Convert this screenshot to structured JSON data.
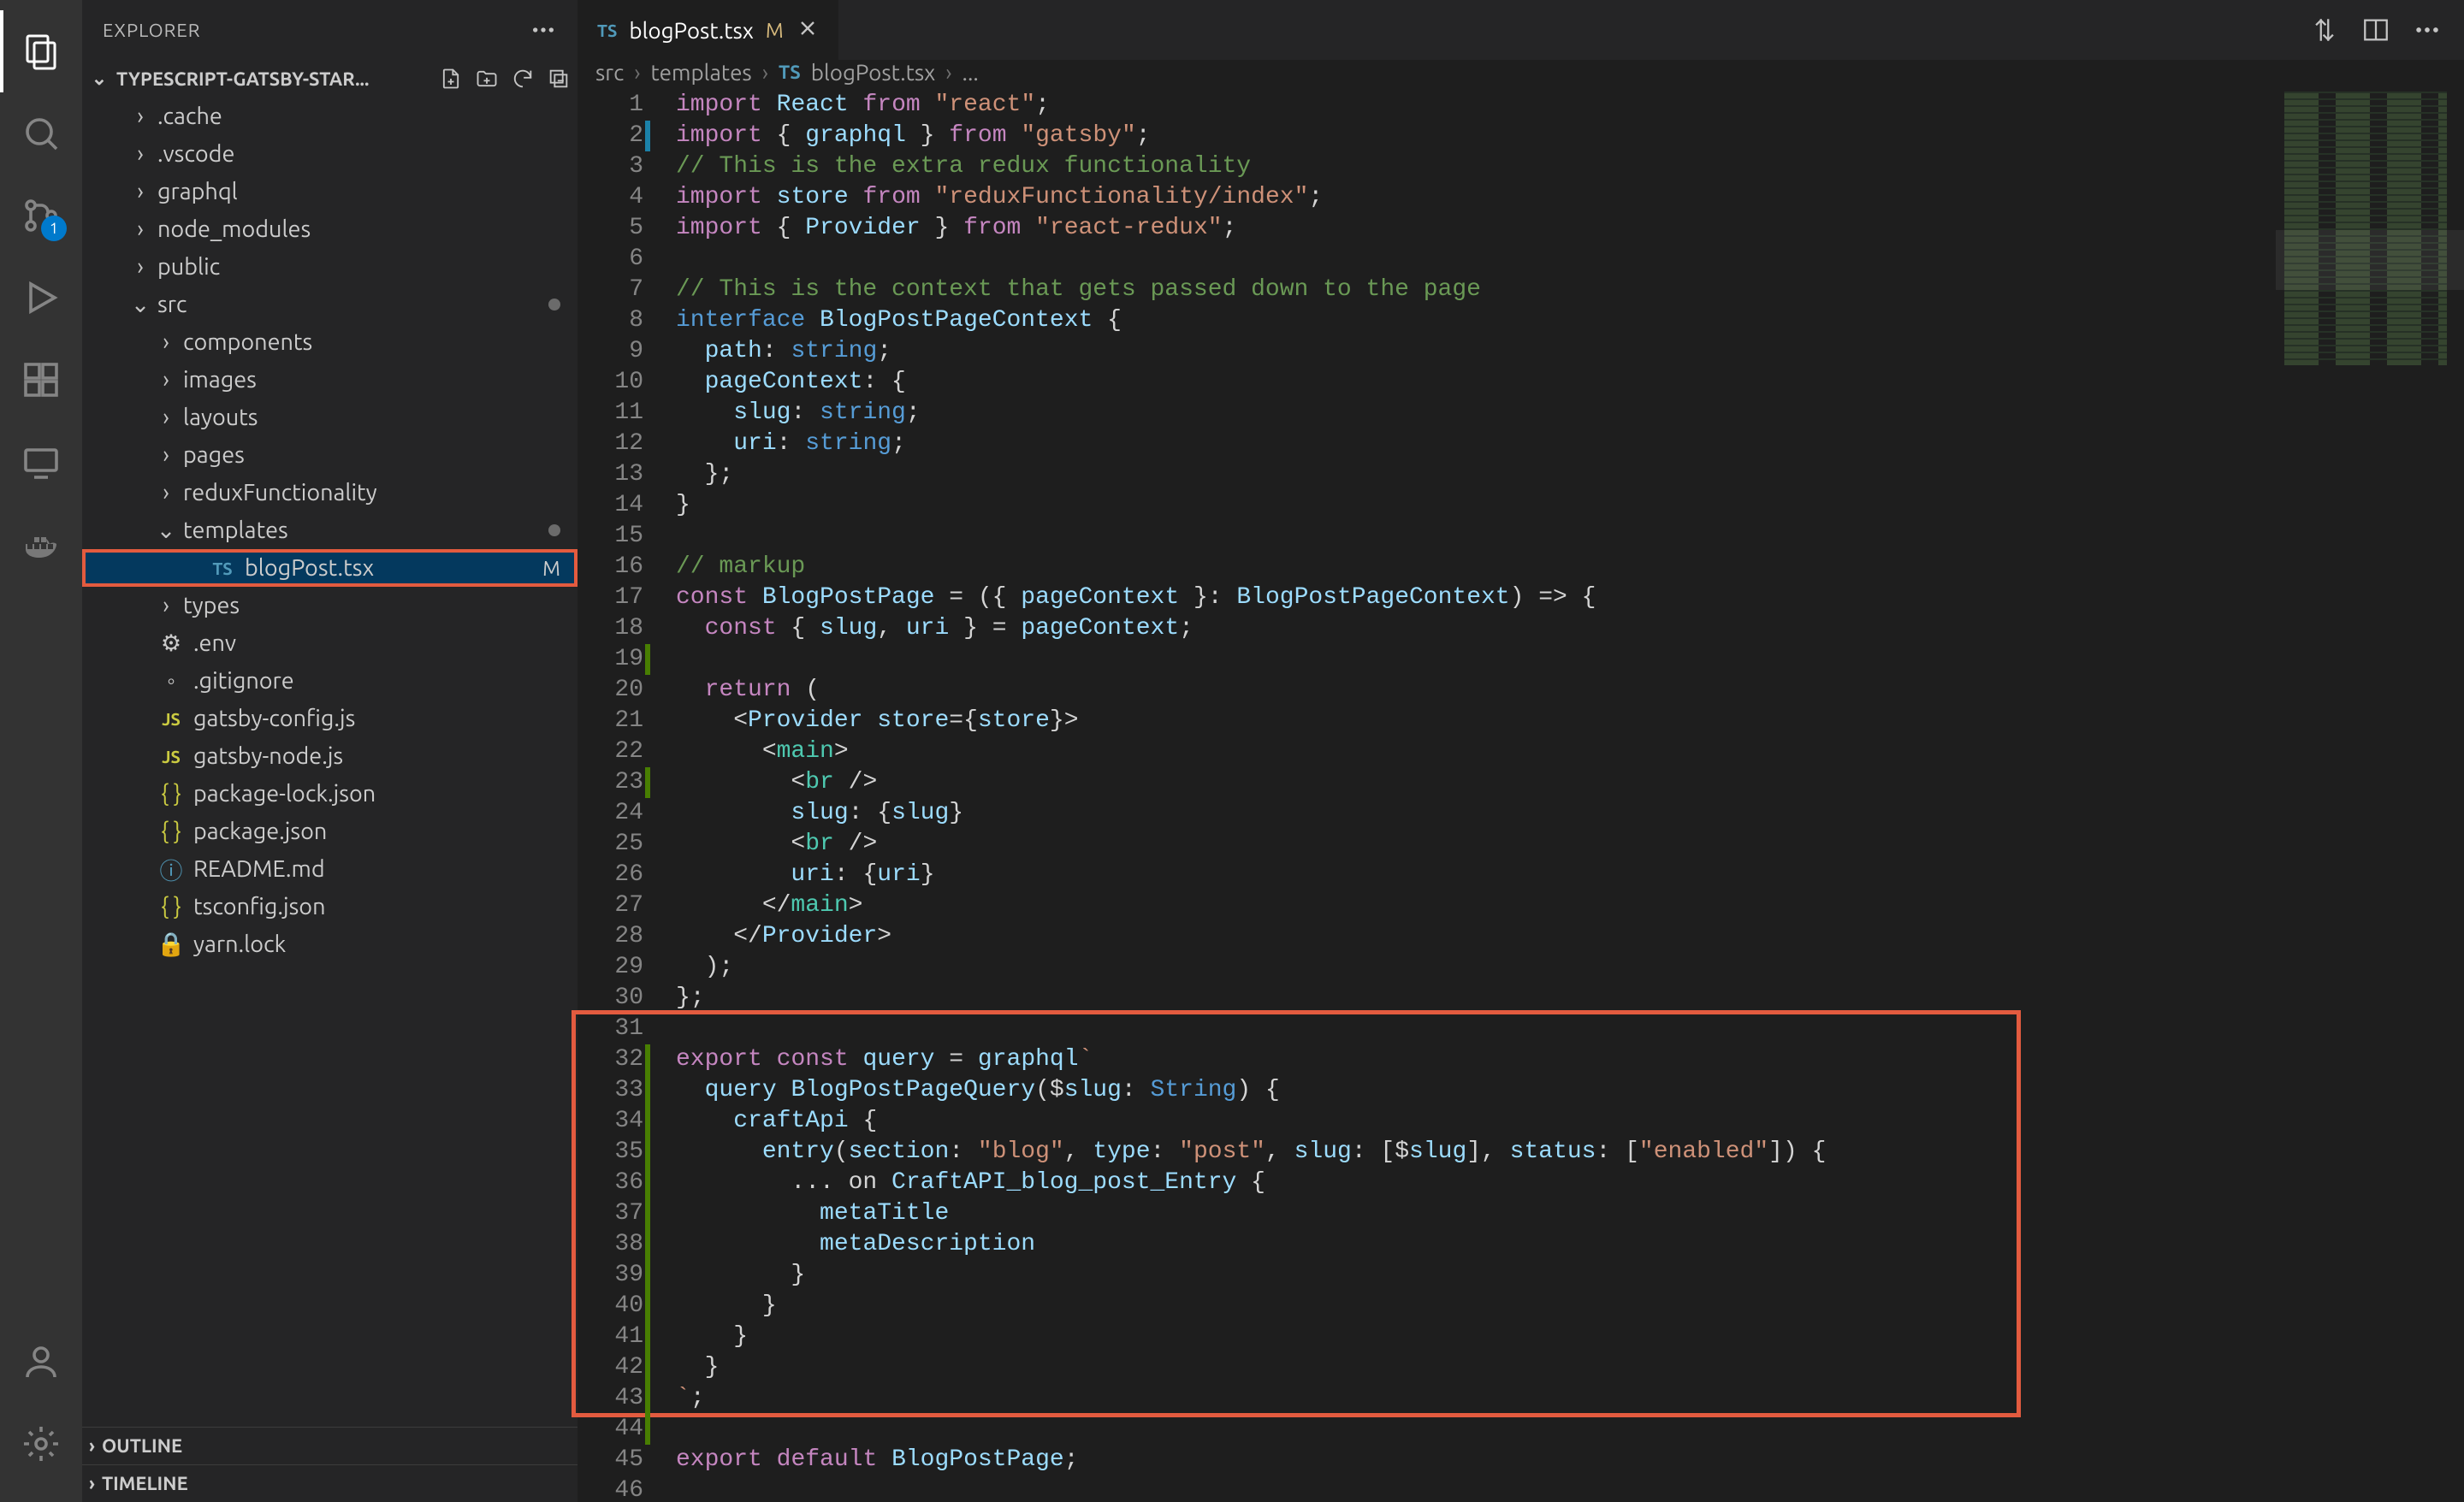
{
  "activity_badge": "1",
  "sidebar": {
    "header": "EXPLORER",
    "project": "TYPESCRIPT-GATSBY-STAR...",
    "outline": "OUTLINE",
    "timeline": "TIMELINE"
  },
  "tree": [
    {
      "depth": 1,
      "chev": ">",
      "name": ".cache",
      "kind": "folder"
    },
    {
      "depth": 1,
      "chev": ">",
      "name": ".vscode",
      "kind": "folder"
    },
    {
      "depth": 1,
      "chev": ">",
      "name": "graphql",
      "kind": "folder"
    },
    {
      "depth": 1,
      "chev": ">",
      "name": "node_modules",
      "kind": "folder"
    },
    {
      "depth": 1,
      "chev": ">",
      "name": "public",
      "kind": "folder"
    },
    {
      "depth": 1,
      "chev": "v",
      "name": "src",
      "kind": "folder",
      "mod": true
    },
    {
      "depth": 2,
      "chev": ">",
      "name": "components",
      "kind": "folder"
    },
    {
      "depth": 2,
      "chev": ">",
      "name": "images",
      "kind": "folder"
    },
    {
      "depth": 2,
      "chev": ">",
      "name": "layouts",
      "kind": "folder"
    },
    {
      "depth": 2,
      "chev": ">",
      "name": "pages",
      "kind": "folder"
    },
    {
      "depth": 2,
      "chev": ">",
      "name": "reduxFunctionality",
      "kind": "folder"
    },
    {
      "depth": 2,
      "chev": "v",
      "name": "templates",
      "kind": "folder",
      "mod": true
    },
    {
      "depth": 3,
      "chev": "",
      "name": "blogPost.tsx",
      "kind": "ts",
      "selected": true,
      "m": "M"
    },
    {
      "depth": 2,
      "chev": ">",
      "name": "types",
      "kind": "folder"
    },
    {
      "depth": 1,
      "chev": "",
      "name": ".env",
      "kind": "env"
    },
    {
      "depth": 1,
      "chev": "",
      "name": ".gitignore",
      "kind": "git"
    },
    {
      "depth": 1,
      "chev": "",
      "name": "gatsby-config.js",
      "kind": "js"
    },
    {
      "depth": 1,
      "chev": "",
      "name": "gatsby-node.js",
      "kind": "js"
    },
    {
      "depth": 1,
      "chev": "",
      "name": "package-lock.json",
      "kind": "json"
    },
    {
      "depth": 1,
      "chev": "",
      "name": "package.json",
      "kind": "json"
    },
    {
      "depth": 1,
      "chev": "",
      "name": "README.md",
      "kind": "md"
    },
    {
      "depth": 1,
      "chev": "",
      "name": "tsconfig.json",
      "kind": "json"
    },
    {
      "depth": 1,
      "chev": "",
      "name": "yarn.lock",
      "kind": "lock"
    }
  ],
  "tab": {
    "name": "blogPost.tsx",
    "mod": "M"
  },
  "breadcrumbs": [
    "src",
    "templates",
    "blogPost.tsx",
    "..."
  ],
  "code": {
    "start_line": 1,
    "lines": [
      "import React from \"react\";",
      "import { graphql } from \"gatsby\";",
      "// This is the extra redux functionality",
      "import store from \"reduxFunctionality/index\";",
      "import { Provider } from \"react-redux\";",
      "",
      "// This is the context that gets passed down to the page",
      "interface BlogPostPageContext {",
      "  path: string;",
      "  pageContext: {",
      "    slug: string;",
      "    uri: string;",
      "  };",
      "}",
      "",
      "// markup",
      "const BlogPostPage = ({ pageContext }: BlogPostPageContext) => {",
      "  const { slug, uri } = pageContext;",
      "",
      "  return (",
      "    <Provider store={store}>",
      "      <main>",
      "        <br />",
      "        slug: {slug}",
      "        <br />",
      "        uri: {uri}",
      "      </main>",
      "    </Provider>",
      "  );",
      "};",
      "",
      "export const query = graphql`",
      "  query BlogPostPageQuery($slug: String) {",
      "    craftApi {",
      "      entry(section: \"blog\", type: \"post\", slug: [$slug], status: [\"enabled\"]) {",
      "        ... on CraftAPI_blog_post_Entry {",
      "          metaTitle",
      "          metaDescription",
      "        }",
      "      }",
      "    }",
      "  }",
      "`;",
      "",
      "export default BlogPostPage;",
      ""
    ]
  },
  "highlights": {
    "file_row_index": 12,
    "code_block": {
      "from_line": 31,
      "to_line": 43
    }
  }
}
